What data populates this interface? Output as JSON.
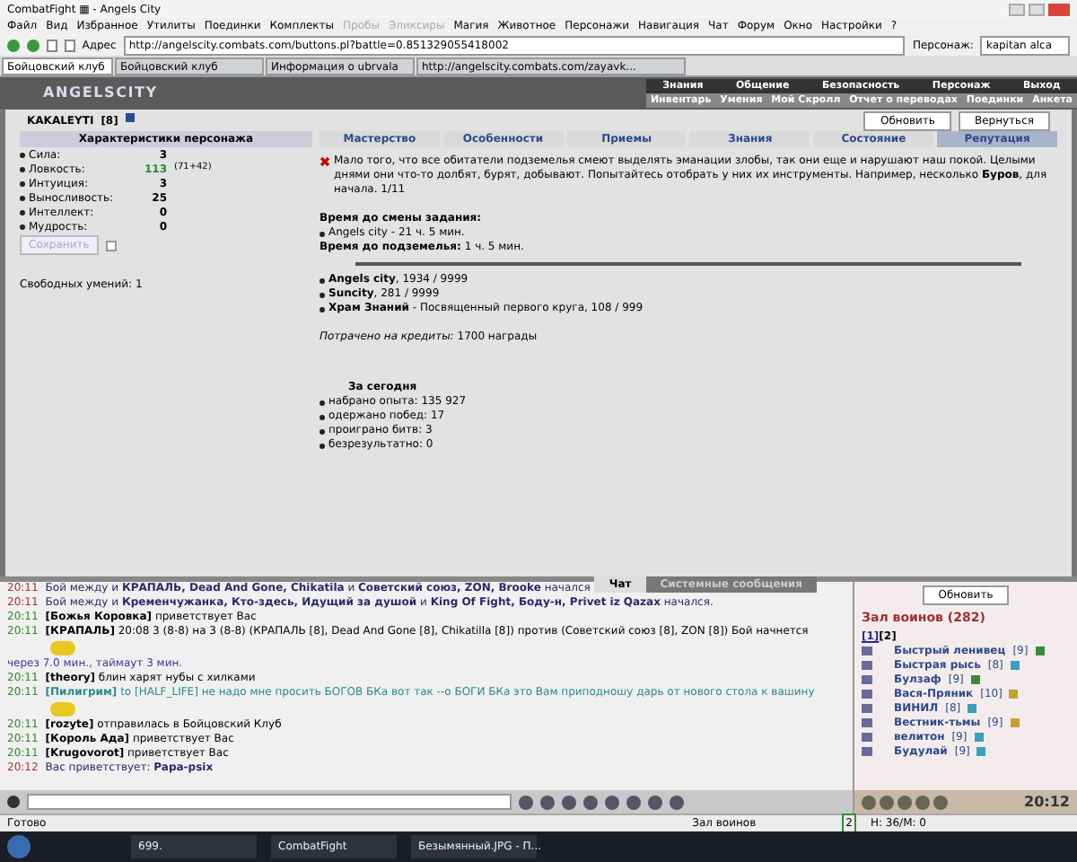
{
  "window": {
    "title": "CombatFight ▦ - Angels City"
  },
  "menu": [
    {
      "label": "Файл",
      "disabled": false
    },
    {
      "label": "Вид",
      "disabled": false
    },
    {
      "label": "Избранное",
      "disabled": false
    },
    {
      "label": "Утилиты",
      "disabled": false
    },
    {
      "label": "Поединки",
      "disabled": false
    },
    {
      "label": "Комплекты",
      "disabled": false
    },
    {
      "label": "Пробы",
      "disabled": true
    },
    {
      "label": "Эликсиры",
      "disabled": true
    },
    {
      "label": "Магия",
      "disabled": false
    },
    {
      "label": "Животное",
      "disabled": false
    },
    {
      "label": "Персонажи",
      "disabled": false
    },
    {
      "label": "Навигация",
      "disabled": false
    },
    {
      "label": "Чат",
      "disabled": false
    },
    {
      "label": "Форум",
      "disabled": false
    },
    {
      "label": "Окно",
      "disabled": false
    },
    {
      "label": "Настройки",
      "disabled": false
    },
    {
      "label": "?",
      "disabled": false
    }
  ],
  "address": {
    "label": "Адрес",
    "value": "http://angelscity.combats.com/buttons.pl?battle=0.851329055418002",
    "character_label": "Персонаж:",
    "character": "kapitan alca"
  },
  "browser_tabs": [
    {
      "label": "Бойцовский клуб",
      "selected": true
    },
    {
      "label": "Бойцовский клуб",
      "selected": false
    },
    {
      "label": "Информация о ubrvala",
      "selected": false
    },
    {
      "label": "http://angelscity.combats.com/zayavk...",
      "selected": false
    }
  ],
  "game": {
    "logo": "ANGELSCITY",
    "nav_top": [
      "Знания",
      "Общение",
      "Безопасность",
      "Персонаж",
      "Выход"
    ],
    "nav_bottom": [
      "Инвентарь",
      "Умения",
      "Мой Скролл",
      "Отчет о переводах",
      "Поединки",
      "Анкета"
    ]
  },
  "character": {
    "name": "KAKALEYTI",
    "level": "[8]",
    "buttons": [
      "Обновить",
      "Вернуться"
    ],
    "stats_title": "Характеристики персонажа",
    "stats": [
      {
        "label": "Сила:",
        "value": "3"
      },
      {
        "label": "Ловкость:",
        "value": "113",
        "bonus": "(71+42)"
      },
      {
        "label": "Интуиция:",
        "value": "3"
      },
      {
        "label": "Выносливость:",
        "value": "25"
      },
      {
        "label": "Интеллект:",
        "value": "0"
      },
      {
        "label": "Мудрость:",
        "value": "0"
      }
    ],
    "save_button": {
      "label": "Сохранить",
      "disabled": true
    },
    "save_checkbox": {
      "checked": false
    },
    "free_skills": "Свободных умений: 1"
  },
  "tabs": [
    {
      "label": "Мастерство",
      "selected": false
    },
    {
      "label": "Особенности",
      "selected": false
    },
    {
      "label": "Приемы",
      "selected": false
    },
    {
      "label": "Знания",
      "selected": false
    },
    {
      "label": "Состояние",
      "selected": false
    },
    {
      "label": "Репутация",
      "selected": true
    }
  ],
  "reputation": {
    "quest": "Мало того, что все обитатели подземелья смеют выделять эманации злобы, так они еще и нарушают наш покой. Целыми днями они что-то долбят, бурят, добывают. Попытайтесь отобрать у них их инструменты. Например, несколько **Буров**, для начала. 1/11",
    "timer_title": "Время до смены задания:",
    "timer_item": "Angels city - 21 ч. 5 мин.",
    "dungeon": "**Время до подземелья:** 1 ч. 5 мин.",
    "cities": [
      "**Angels city**, 1934 / 9999",
      "**Suncity**, 281 / 9999",
      "**Храм Знаний** - Посвященный первого круга, 108 / 999"
    ],
    "spent": "*Потрачено на кредиты:* 1700 награды",
    "today_title": "За сегодня",
    "today": [
      "набрано опыта: 135 927",
      "одержано побед: 17",
      "проиграно битв: 3",
      "безрезультатно: 0"
    ]
  },
  "chat": {
    "tabs": [
      {
        "label": "Чат",
        "selected": true
      },
      {
        "label": "Системные сообщения",
        "selected": false
      }
    ],
    "lines": [
      {
        "kind": "system",
        "time": "20:11",
        "text": "Бой между и **КРАПАЛЬ, Dead And Gone, Chikatila** и **Советский союз, ZON, Brooke** начался"
      },
      {
        "kind": "system",
        "time": "20:11",
        "text": "Бой между и **Кременчужанка, Кто-здесь, Идущий за душой** и **King Of Fight, Боду-н, Privet iz Qazax** начался."
      },
      {
        "kind": "normal",
        "time": "20:11",
        "text": "**[Божья Коровка]** приветствует Вас"
      },
      {
        "kind": "normal",
        "time": "20:11",
        "text": "**[КРАПАЛЬ]** 20:08 3 (8-8) на 3 (8-8) (КРАПАЛЬ [8], Dead And Gone [8], Chikatilla [8]) против (Советский союз [8], ZON [8]) Бой начнется"
      },
      {
        "kind": "smiley"
      },
      {
        "kind": "note",
        "text": "через 7.0 мин., таймаут 3 мин."
      },
      {
        "kind": "normal",
        "time": "20:11",
        "text": "**[theory]** блин харят нубы с хилками"
      },
      {
        "kind": "private",
        "time": "20:11",
        "text": "**[Пилигрим]** to [HALF_LIFE] не надо мне просить БОГОВ БКа вот так --о БОГИ БКа это Вам приподношу дарь от нового стола к вашину"
      },
      {
        "kind": "smiley"
      },
      {
        "kind": "normal",
        "time": "20:11",
        "text": "**[rozyte]** отправилась в Бойцовский Клуб"
      },
      {
        "kind": "normal",
        "time": "20:11",
        "text": "**[Король Ада]** приветствует Вас"
      },
      {
        "kind": "normal",
        "time": "20:11",
        "text": "**[Krugovorot]** приветствует Вас"
      },
      {
        "kind": "system",
        "time": "20:12",
        "text": "Вас приветствует: **Papa-psix**"
      }
    ]
  },
  "online": {
    "button": "Обновить",
    "title": "Зал воинов (282)",
    "pages": [
      {
        "label": "[1]",
        "selected": true
      },
      {
        "label": "[2]",
        "selected": false
      }
    ],
    "users": [
      {
        "name": "Быстрый ленивец",
        "level": "[9]",
        "color": "#3a8a3a"
      },
      {
        "name": "Быстрая рысь",
        "level": "[8]",
        "color": "#3aa0c0"
      },
      {
        "name": "Булзаф",
        "level": "[9]",
        "color": "#3a8a3a"
      },
      {
        "name": "Вася-Пряник",
        "level": "[10]",
        "color": "#c8a030"
      },
      {
        "name": "ВИНИЛ",
        "level": "[8]",
        "color": "#3aa0c0"
      },
      {
        "name": "Вестник-тьмы",
        "level": "[9]",
        "color": "#c8a030"
      },
      {
        "name": "велитон",
        "level": "[9]",
        "color": "#3aa0c0"
      },
      {
        "name": "Будулай",
        "level": "[9]",
        "color": "#3aa0c0"
      }
    ]
  },
  "clock": "20:12",
  "status_bar": {
    "text": "Готово",
    "room": "Зал воинов",
    "count": "2",
    "hp": "H: 36/M: 0"
  },
  "taskbar": [
    "699.",
    "CombatFight",
    "Безымянный.JPG - П..."
  ]
}
